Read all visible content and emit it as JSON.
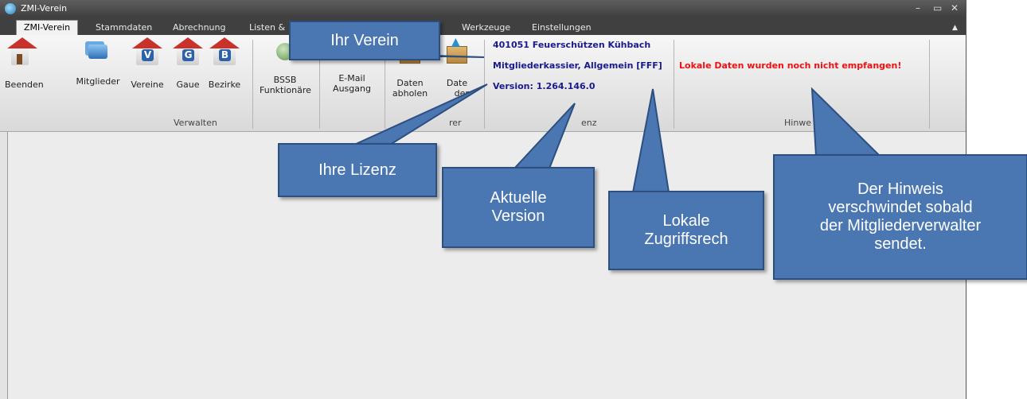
{
  "window": {
    "title": "ZMI-Verein",
    "controls": [
      "–",
      "▭",
      "✕"
    ]
  },
  "tabs": [
    {
      "label": "ZMI-Verein",
      "active": true
    },
    {
      "label": "Stammdaten"
    },
    {
      "label": "Abrechnung"
    },
    {
      "label": "Listen &"
    },
    {
      "label": "Werkzeuge"
    },
    {
      "label": "Einstellungen"
    }
  ],
  "ribbon": {
    "buttons": {
      "beenden": "Beenden",
      "mitglieder": "Mitglieder",
      "vereine": "Vereine",
      "gaue": "Gaue",
      "bezirke": "Bezirke",
      "bssb_line1": "BSSB",
      "bssb_line2": "Funktionäre",
      "email_line1": "E-Mail",
      "email_line2": "Ausgang",
      "daten_abholen_line1": "Daten",
      "daten_abholen_line2": "abholen",
      "daten_senden_line1": "Date",
      "daten_senden_line2": "den"
    },
    "groups": {
      "verwalten": "Verwalten",
      "transfer": "rer",
      "lizenz": "enz",
      "hinweis": "Hinwe"
    },
    "license": {
      "verein": "401051 Feuerschützen Kühbach",
      "rolle": "Mitgliederkassier, Allgemein [FFF]",
      "version": "Version: 1.264.146.0"
    },
    "warning": "Lokale Daten wurden noch nicht empfangen!",
    "icon_letters": {
      "vereine": "V",
      "gaue": "G",
      "bezirke": "B"
    }
  },
  "callouts": {
    "verein": "Ihr Verein",
    "lizenz": "Ihre Lizenz",
    "version": [
      "Aktuelle",
      "Version"
    ],
    "rechte": [
      "Lokale",
      "Zugriffsrech"
    ],
    "hinweis": [
      "Der Hinweis",
      "verschwindet sobald",
      "der Mitgliederverwalter",
      "sendet."
    ]
  },
  "colors": {
    "callout_fill": "#4a77b2",
    "license_text": "#1a1a8c",
    "warning_text": "#ee1111"
  }
}
